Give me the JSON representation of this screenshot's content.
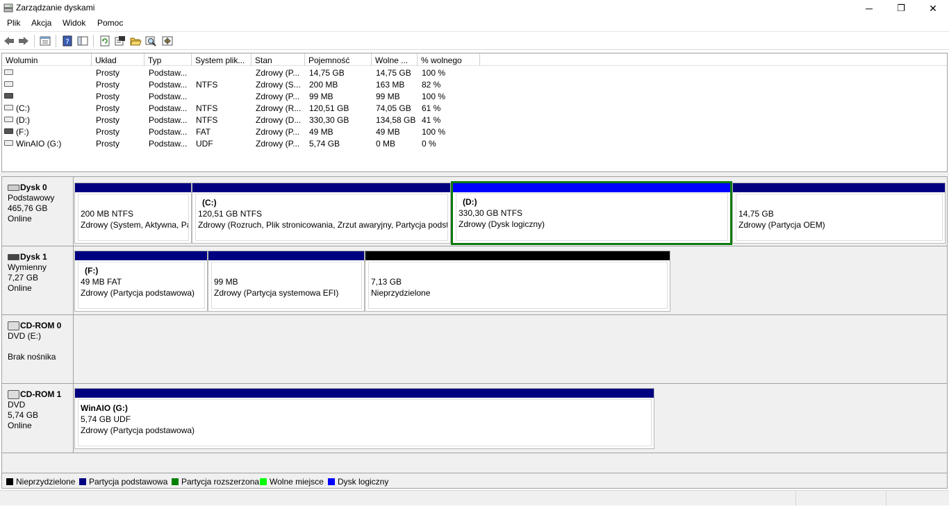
{
  "window": {
    "title": "Zarządzanie dyskami",
    "min_glyph": "─",
    "max_glyph": "❐",
    "close_glyph": "✕"
  },
  "menu": [
    "Plik",
    "Akcja",
    "Widok",
    "Pomoc"
  ],
  "toolbar_icons": [
    "back-arrow-icon",
    "forward-arrow-icon",
    "properties-list-icon",
    "help-icon",
    "console-tree-icon",
    "refresh-icon",
    "disk-properties-icon",
    "open-folder-icon",
    "search-icon",
    "settings-icon"
  ],
  "volumes": {
    "columns": [
      "Wolumin",
      "Układ",
      "Typ",
      "System plik...",
      "Stan",
      "Pojemność",
      "Wolne ...",
      "% wolnego"
    ],
    "rows": [
      {
        "name": "",
        "layout": "Prosty",
        "type": "Podstaw...",
        "fs": "",
        "status": "Zdrowy (P...",
        "capacity": "14,75 GB",
        "free": "14,75 GB",
        "pct": "100 %"
      },
      {
        "name": "",
        "layout": "Prosty",
        "type": "Podstaw...",
        "fs": "NTFS",
        "status": "Zdrowy (S...",
        "capacity": "200 MB",
        "free": "163 MB",
        "pct": "82 %"
      },
      {
        "name": "",
        "layout": "Prosty",
        "type": "Podstaw...",
        "fs": "",
        "status": "Zdrowy (P...",
        "capacity": "99 MB",
        "free": "99 MB",
        "pct": "100 %"
      },
      {
        "name": "(C:)",
        "layout": "Prosty",
        "type": "Podstaw...",
        "fs": "NTFS",
        "status": "Zdrowy (R...",
        "capacity": "120,51 GB",
        "free": "74,05 GB",
        "pct": "61 %"
      },
      {
        "name": "(D:)",
        "layout": "Prosty",
        "type": "Podstaw...",
        "fs": "NTFS",
        "status": "Zdrowy (D...",
        "capacity": "330,30 GB",
        "free": "134,58 GB",
        "pct": "41 %"
      },
      {
        "name": "(F:)",
        "layout": "Prosty",
        "type": "Podstaw...",
        "fs": "FAT",
        "status": "Zdrowy (P...",
        "capacity": "49 MB",
        "free": "49 MB",
        "pct": "100 %"
      },
      {
        "name": "WinAIO (G:)",
        "layout": "Prosty",
        "type": "Podstaw...",
        "fs": "UDF",
        "status": "Zdrowy (P...",
        "capacity": "5,74 GB",
        "free": "0 MB",
        "pct": "0 %"
      }
    ]
  },
  "disks": [
    {
      "name": "Dysk 0",
      "type": "Podstawowy",
      "size": "465,76 GB",
      "state": "Online",
      "partitions": [
        {
          "label": "",
          "line1": "200 MB NTFS",
          "line2": "Zdrowy (System, Aktywna, Pa"
        },
        {
          "label": "(C:)",
          "line1": "120,51 GB NTFS",
          "line2": "Zdrowy (Rozruch, Plik stronicowania, Zrzut awaryjny, Partycja podst"
        },
        {
          "label": "(D:)",
          "line1": "330,30 GB NTFS",
          "line2": "Zdrowy (Dysk logiczny)"
        },
        {
          "label": "",
          "line1": "14,75 GB",
          "line2": "Zdrowy (Partycja OEM)"
        }
      ]
    },
    {
      "name": "Dysk 1",
      "type": "Wymienny",
      "size": "7,27 GB",
      "state": "Online",
      "partitions": [
        {
          "label": "(F:)",
          "line1": "49 MB FAT",
          "line2": "Zdrowy (Partycja podstawowa)"
        },
        {
          "label": "",
          "line1": "99 MB",
          "line2": "Zdrowy (Partycja systemowa EFI)"
        },
        {
          "label": "",
          "line1": "7,13 GB",
          "line2": "Nieprzydzielone"
        }
      ]
    },
    {
      "name": "CD-ROM 0",
      "type": "DVD (E:)",
      "size": "",
      "state": "Brak nośnika",
      "partitions": []
    },
    {
      "name": "CD-ROM 1",
      "type": "DVD",
      "size": "5,74 GB",
      "state": "Online",
      "partitions": [
        {
          "label": "WinAIO  (G:)",
          "line1": "5,74 GB UDF",
          "line2": "Zdrowy (Partycja podstawowa)"
        }
      ]
    }
  ],
  "legend": [
    {
      "label": "Nieprzydzielone",
      "color": "#000000"
    },
    {
      "label": "Partycja podstawowa",
      "color": "#000080"
    },
    {
      "label": "Partycja rozszerzona",
      "color": "#008000"
    },
    {
      "label": "Wolne miejsce",
      "color": "#00ff00"
    },
    {
      "label": "Dysk logiczny",
      "color": "#0000ff"
    }
  ],
  "colors": {
    "primary": "#000080",
    "logical": "#0000ff",
    "unallocated": "#000000",
    "selection": "#0e7a0e"
  }
}
